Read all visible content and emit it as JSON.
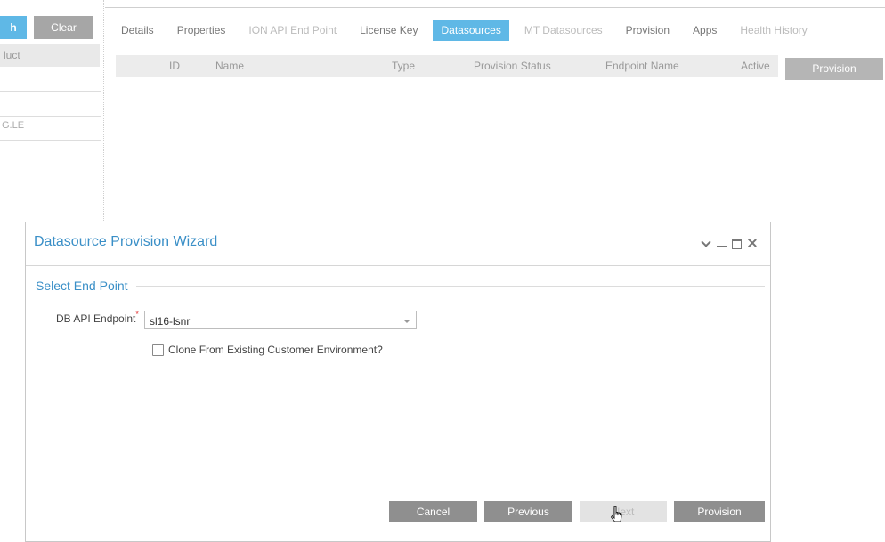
{
  "left_panel": {
    "search_label": "h",
    "clear_label": "Clear",
    "product_label": "luct",
    "row_text": "G.LE"
  },
  "tabs": [
    {
      "label": "Details",
      "state": "normal"
    },
    {
      "label": "Properties",
      "state": "normal"
    },
    {
      "label": "ION API End Point",
      "state": "disabled"
    },
    {
      "label": "License Key",
      "state": "normal"
    },
    {
      "label": "Datasources",
      "state": "active"
    },
    {
      "label": "MT Datasources",
      "state": "disabled"
    },
    {
      "label": "Provision",
      "state": "normal"
    },
    {
      "label": "Apps",
      "state": "normal"
    },
    {
      "label": "Health History",
      "state": "disabled"
    }
  ],
  "table": {
    "columns": [
      "ID",
      "Name",
      "Type",
      "Provision Status",
      "Endpoint Name",
      "Active"
    ],
    "rows": []
  },
  "provision_button_label": "Provision",
  "dialog": {
    "title": "Datasource Provision Wizard",
    "section_title": "Select End Point",
    "endpoint_label": "DB API Endpoint",
    "required_mark": "*",
    "endpoint_value": "sl16-lsnr",
    "clone_label": "Clone From Existing Customer Environment?",
    "clone_checked": false,
    "buttons": {
      "cancel": "Cancel",
      "previous": "Previous",
      "next": "Next",
      "provision": "Provision"
    }
  },
  "colors": {
    "accent": "#5fb8e6",
    "title_blue": "#3a8fc7",
    "button_gray": "#8f8f8f"
  }
}
